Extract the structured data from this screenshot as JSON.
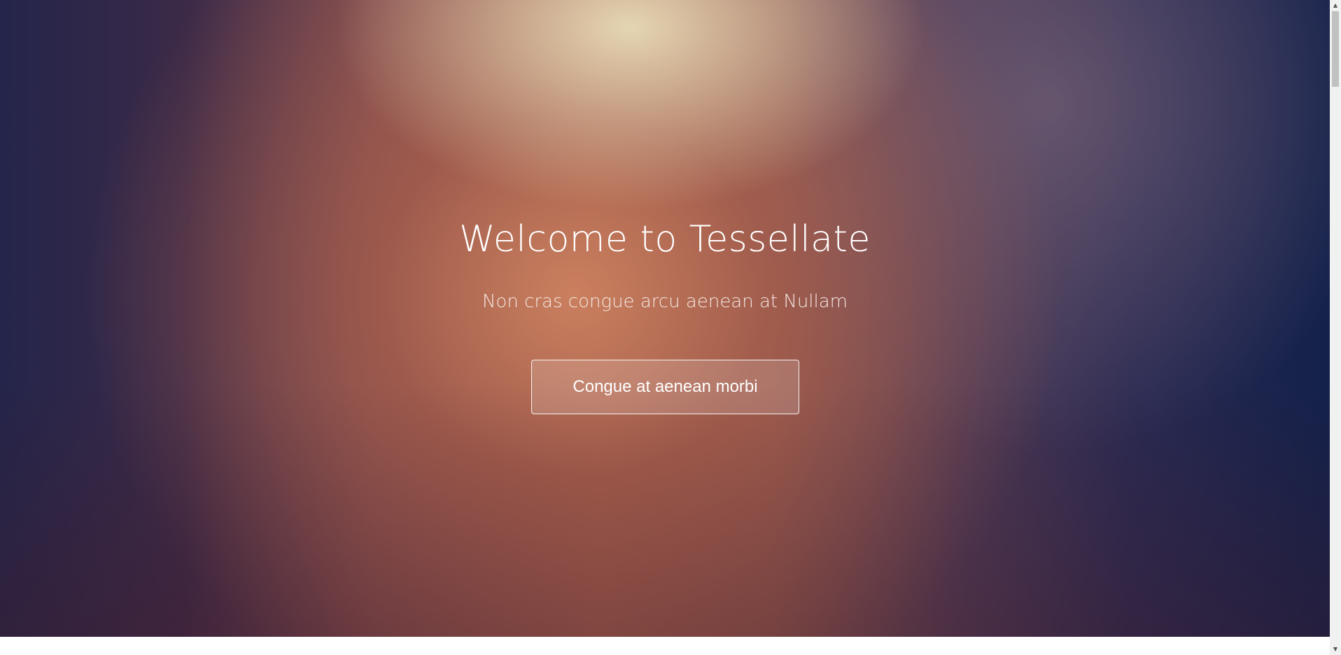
{
  "hero": {
    "title": "Welcome to Tessellate",
    "subtitle": "Non cras congue arcu aenean at Nullam",
    "cta_label": "Congue at aenean morbi"
  },
  "scrollbar": {
    "up_arrow_icon": "triangle-up-icon",
    "down_arrow_icon": "triangle-down-icon"
  },
  "colors": {
    "hero_top": "#e8dcb8",
    "hero_center": "#b8705a",
    "hero_edge_left": "#24254a",
    "hero_edge_right": "#13214b",
    "text": "#ffffff"
  }
}
